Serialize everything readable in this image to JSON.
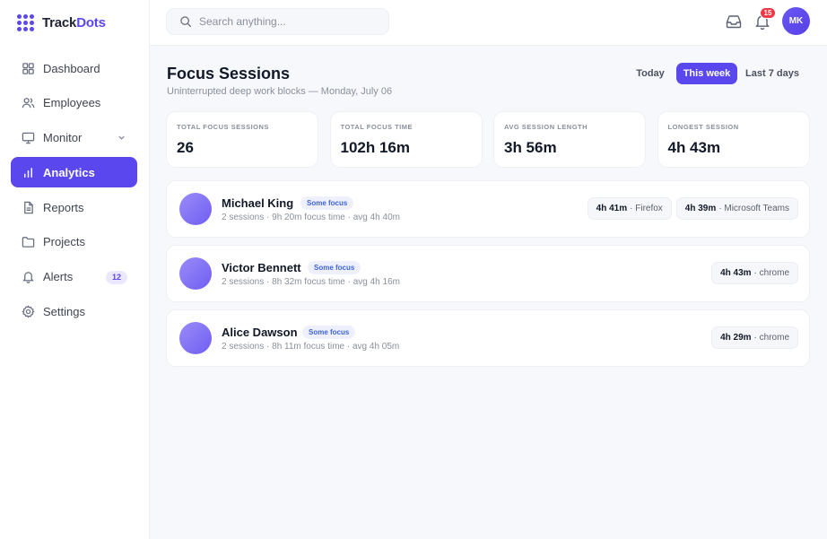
{
  "brand": {
    "name_part1": "Track",
    "name_part2": "Dots",
    "accent": "#5b47ee"
  },
  "sidebar": {
    "items": [
      {
        "label": "Dashboard",
        "icon": "grid-icon"
      },
      {
        "label": "Employees",
        "icon": "users-icon"
      },
      {
        "label": "Monitor",
        "icon": "monitor-icon",
        "has_chevron": true
      },
      {
        "label": "Analytics",
        "icon": "bar-chart-icon",
        "active": true
      },
      {
        "label": "Reports",
        "icon": "file-icon"
      },
      {
        "label": "Projects",
        "icon": "folder-icon"
      },
      {
        "label": "Alerts",
        "icon": "bell-icon",
        "badge": "12"
      },
      {
        "label": "Settings",
        "icon": "gear-icon"
      }
    ]
  },
  "topbar": {
    "search_placeholder": "Search anything...",
    "notification_count": "15",
    "user_initials": "MK"
  },
  "page": {
    "title": "Focus Sessions",
    "subtitle": "Uninterrupted deep work blocks — Monday, July 06",
    "range_tabs": [
      {
        "label": "Today",
        "active": false
      },
      {
        "label": "This week",
        "active": true
      },
      {
        "label": "Last 7 days",
        "active": false
      }
    ]
  },
  "stats": [
    {
      "label": "TOTAL FOCUS SESSIONS",
      "value": "26"
    },
    {
      "label": "TOTAL FOCUS TIME",
      "value": "102h 16m"
    },
    {
      "label": "AVG SESSION LENGTH",
      "value": "3h 56m"
    },
    {
      "label": "LONGEST SESSION",
      "value": "4h 43m"
    }
  ],
  "people": [
    {
      "name": "Michael King",
      "tag": "Some focus",
      "meta": "2 sessions · 9h 20m focus time · avg 4h 40m",
      "chips": [
        {
          "time": "4h 41m",
          "app": "· Firefox"
        },
        {
          "time": "4h 39m",
          "app": "· Microsoft Teams"
        }
      ]
    },
    {
      "name": "Victor Bennett",
      "tag": "Some focus",
      "meta": "2 sessions · 8h 32m focus time · avg 4h 16m",
      "chips": [
        {
          "time": "4h 43m",
          "app": "· chrome"
        }
      ]
    },
    {
      "name": "Alice Dawson",
      "tag": "Some focus",
      "meta": "2 sessions · 8h 11m focus time · avg 4h 05m",
      "chips": [
        {
          "time": "4h 29m",
          "app": "· chrome"
        }
      ]
    }
  ]
}
